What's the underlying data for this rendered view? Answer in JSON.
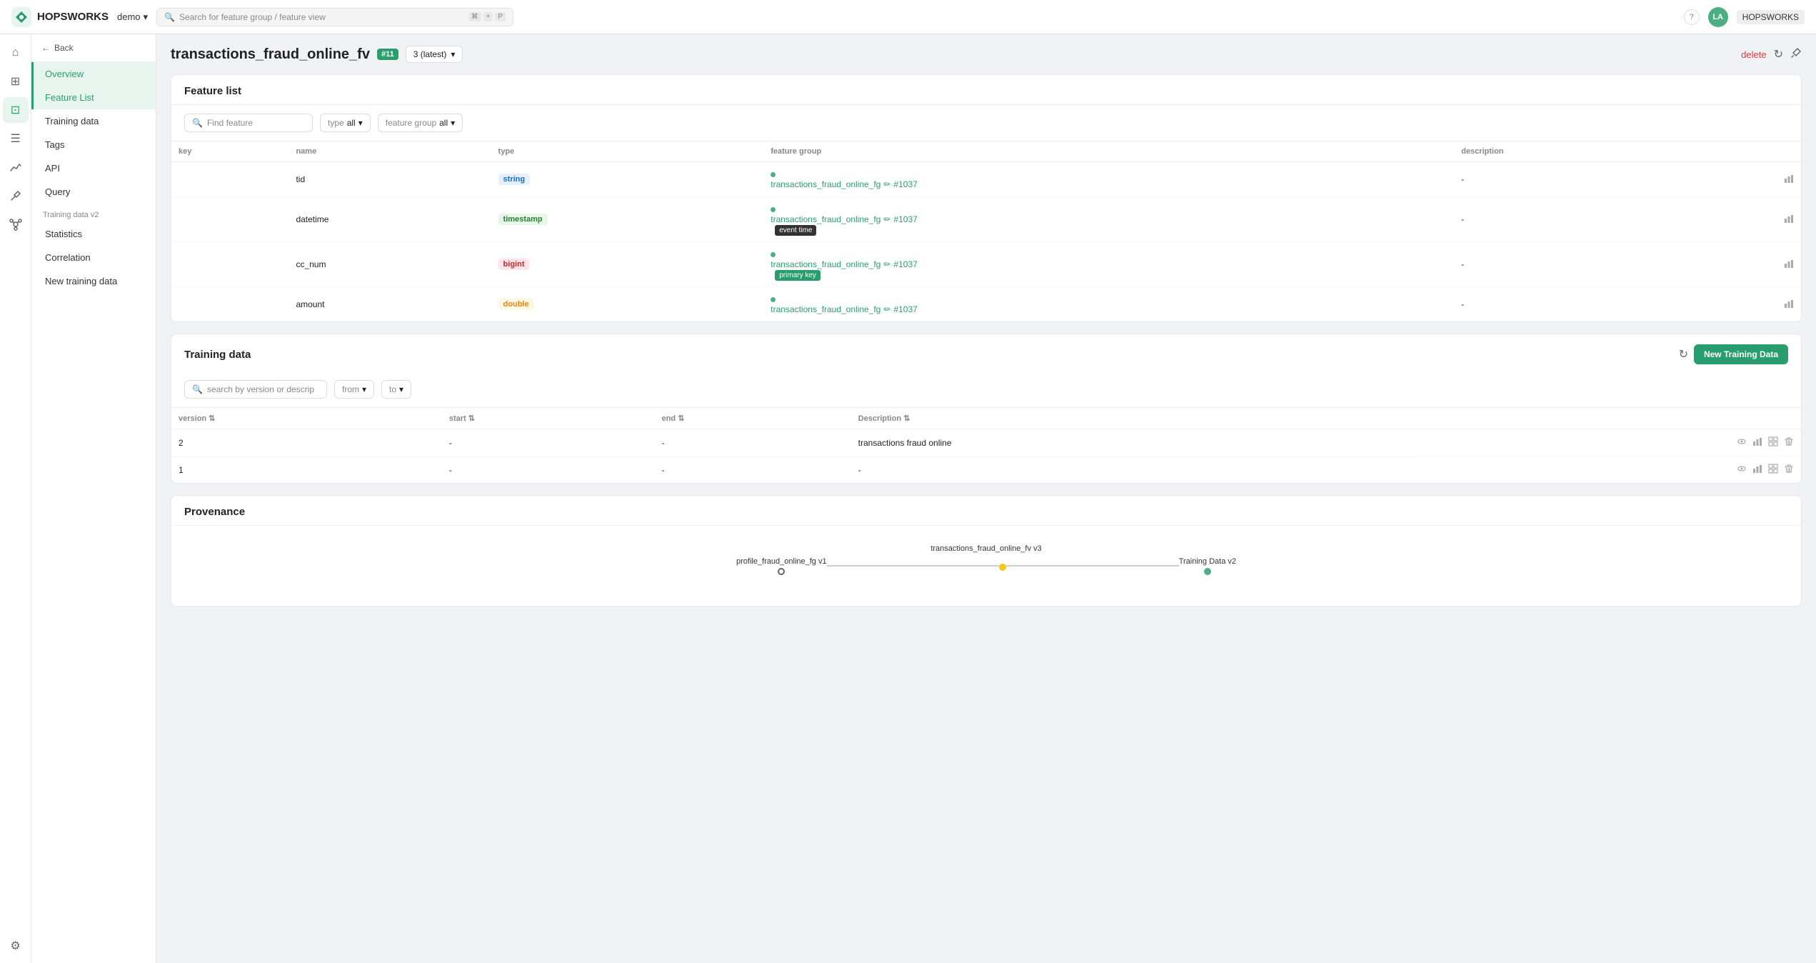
{
  "app": {
    "logo_text": "HOPSWORKS",
    "project_name": "demo",
    "search_placeholder": "Search for feature group / feature view",
    "search_shortcut": "⌘ + P",
    "user_initials": "LA"
  },
  "sidebar": {
    "back_label": "Back",
    "items": [
      {
        "id": "overview",
        "label": "Overview",
        "active": true
      },
      {
        "id": "feature-list",
        "label": "Feature List",
        "active": false,
        "highlighted": true
      },
      {
        "id": "training-data",
        "label": "Training data",
        "active": false
      },
      {
        "id": "tags",
        "label": "Tags",
        "active": false
      },
      {
        "id": "api",
        "label": "API",
        "active": false
      },
      {
        "id": "query",
        "label": "Query",
        "active": false
      }
    ],
    "section_label": "Training data v2",
    "sub_items": [
      {
        "id": "statistics",
        "label": "Statistics"
      },
      {
        "id": "correlation",
        "label": "Correlation"
      }
    ],
    "bottom_item": "New training data"
  },
  "page": {
    "title": "transactions_fraud_online_fv",
    "version_badge": "#11",
    "version_selector": "3 (latest)",
    "delete_label": "delete",
    "actions": {
      "refresh_title": "Refresh",
      "pin_title": "Pin"
    }
  },
  "feature_list": {
    "section_title": "Feature list",
    "search_placeholder": "Find feature",
    "type_filter_label": "type",
    "type_filter_value": "all",
    "fg_filter_label": "feature group",
    "fg_filter_value": "all",
    "columns": [
      "key",
      "name",
      "type",
      "feature group",
      "description"
    ],
    "rows": [
      {
        "key": "",
        "name": "tid",
        "type": "string",
        "type_class": "type-string",
        "fg_name": "transactions_fraud_online_fg",
        "fg_version": "#1037",
        "tags": [],
        "description": "-"
      },
      {
        "key": "",
        "name": "datetime",
        "type": "timestamp",
        "type_class": "type-timestamp",
        "fg_name": "transactions_fraud_online_fg",
        "fg_version": "#1037",
        "tags": [
          "event time"
        ],
        "description": "-"
      },
      {
        "key": "",
        "name": "cc_num",
        "type": "bigint",
        "type_class": "type-bigint",
        "fg_name": "transactions_fraud_online_fg",
        "fg_version": "#1037",
        "tags": [
          "primary key"
        ],
        "description": "-"
      },
      {
        "key": "",
        "name": "amount",
        "type": "double",
        "type_class": "type-double",
        "fg_name": "transactions_fraud_online_fg",
        "fg_version": "#1037",
        "tags": [],
        "description": "-"
      }
    ]
  },
  "training_data": {
    "section_title": "Training data",
    "new_button_label": "New Training Data",
    "search_placeholder": "search by version or descrip",
    "from_label": "from",
    "to_label": "to",
    "columns": [
      "version",
      "start",
      "end",
      "Description"
    ],
    "rows": [
      {
        "version": "2",
        "start": "-",
        "end": "-",
        "description": "transactions fraud online"
      },
      {
        "version": "1",
        "start": "-",
        "end": "-",
        "description": "-"
      }
    ]
  },
  "provenance": {
    "section_title": "Provenance",
    "nodes": [
      {
        "id": "profile",
        "label": "profile_fraud_online_fg v1"
      },
      {
        "id": "center",
        "label": "transactions_fraud_online_fv v3"
      },
      {
        "id": "training",
        "label": "Training Data v2"
      }
    ]
  },
  "icons": {
    "home": "⌂",
    "layers": "⊞",
    "grid": "⊡",
    "list": "☰",
    "analytics": "📊",
    "refresh": "↻",
    "settings": "⚙",
    "help": "?",
    "pin": "📌",
    "eye": "👁",
    "bar_chart": "📊",
    "table_icon": "⊞",
    "trash": "🗑",
    "edit": "✏",
    "search": "🔍",
    "chevron_down": "▾",
    "arrow_left": "←",
    "more_vert": "⋮",
    "chart_bar": "▐"
  }
}
